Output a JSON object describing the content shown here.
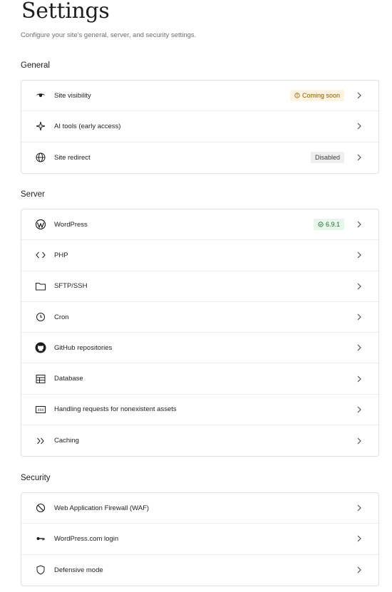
{
  "header": {
    "title": "Settings",
    "subtitle": "Configure your site's general, server, and security settings."
  },
  "sections": {
    "general": {
      "title": "General",
      "items": [
        {
          "label": "Site visibility",
          "icon": "eye-icon",
          "badge": "Coming soon"
        },
        {
          "label": "AI tools (early access)",
          "icon": "sparkle-icon"
        },
        {
          "label": "Site redirect",
          "icon": "globe-icon",
          "badge": "Disabled"
        }
      ]
    },
    "server": {
      "title": "Server",
      "items": [
        {
          "label": "WordPress",
          "icon": "wordpress-icon",
          "badge": "6.9.1"
        },
        {
          "label": "PHP",
          "icon": "code-icon"
        },
        {
          "label": "SFTP/SSH",
          "icon": "folder-icon"
        },
        {
          "label": "Cron",
          "icon": "clock-icon"
        },
        {
          "label": "GitHub repositories",
          "icon": "github-icon"
        },
        {
          "label": "Database",
          "icon": "table-icon"
        },
        {
          "label": "Handling requests for nonexistent assets",
          "icon": "404-icon"
        },
        {
          "label": "Caching",
          "icon": "double-chevron-icon"
        }
      ]
    },
    "security": {
      "title": "Security",
      "items": [
        {
          "label": "Web Application Firewall (WAF)",
          "icon": "block-icon"
        },
        {
          "label": "WordPress.com login",
          "icon": "key-icon"
        },
        {
          "label": "Defensive mode",
          "icon": "shield-icon"
        }
      ]
    }
  },
  "colors": {
    "warn_badge_bg": "#fcf3e3",
    "warn_badge_text": "#8a5a00",
    "success_badge_bg": "#e8f5ea",
    "success_badge_text": "#1c6b2c",
    "neutral_badge_bg": "#efefef"
  }
}
